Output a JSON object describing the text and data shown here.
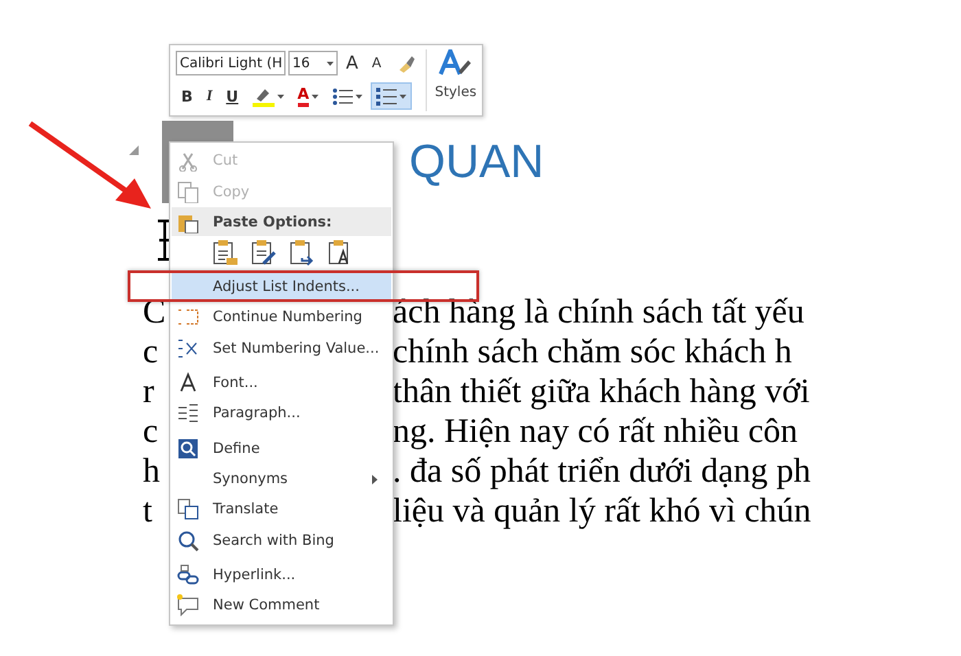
{
  "mini_toolbar": {
    "font": {
      "value": "Calibri Light (H"
    },
    "size": {
      "value": "16"
    },
    "row_1": [
      {
        "kind": "grow",
        "label": "A"
      },
      {
        "kind": "shrink",
        "label": "A"
      },
      {
        "kind": "painter"
      }
    ],
    "row_2": [
      {
        "kind": "bold",
        "label": "B",
        "selected": false
      },
      {
        "kind": "italic",
        "label": "I",
        "selected": false
      },
      {
        "kind": "underline",
        "label": "U",
        "selected": false
      },
      {
        "kind": "highlight",
        "selected": false
      },
      {
        "kind": "font_color",
        "label": "A",
        "selected": false
      },
      {
        "kind": "bullets",
        "selected": false
      },
      {
        "kind": "numbering",
        "selected": true
      }
    ],
    "styles_label": "Styles"
  },
  "document": {
    "heading": "QUAN",
    "lines": [
      {
        "start": "C",
        "rest": "ách hàng là chính sách tất yếu"
      },
      {
        "start": "c",
        "rest": "chính sách chăm sóc khách h"
      },
      {
        "start": "r",
        "rest": "thân thiết giữa khách hàng với"
      },
      {
        "start": "c",
        "rest": "ng. Hiện nay có rất nhiều côn"
      },
      {
        "start": "h",
        "rest": ". đa số phát triển dưới dạng ph"
      },
      {
        "start": "t",
        "rest": "liệu và quản lý rất khó vì chún"
      }
    ]
  },
  "context_menu": {
    "items": [
      {
        "kind": "command",
        "label": "Cut",
        "disabled": true,
        "selected": false,
        "submenu": false,
        "separator_before": false
      },
      {
        "kind": "command",
        "label": "Copy",
        "disabled": true,
        "selected": false,
        "submenu": false,
        "separator_before": false
      },
      {
        "kind": "header",
        "label": "Paste Options:"
      },
      {
        "kind": "paste_icons"
      },
      {
        "kind": "command",
        "label": "Adjust List Indents...",
        "disabled": false,
        "selected": true,
        "submenu": false,
        "separator_before": true
      },
      {
        "kind": "command",
        "label": "Continue Numbering",
        "disabled": false,
        "selected": false,
        "submenu": false,
        "separator_before": false
      },
      {
        "kind": "command",
        "label": "Set Numbering Value...",
        "disabled": false,
        "selected": false,
        "submenu": false,
        "separator_before": false
      },
      {
        "kind": "command",
        "label": "Font...",
        "disabled": false,
        "selected": false,
        "submenu": false,
        "separator_before": true
      },
      {
        "kind": "command",
        "label": "Paragraph...",
        "disabled": false,
        "selected": false,
        "submenu": false,
        "separator_before": false
      },
      {
        "kind": "command",
        "label": "Define",
        "disabled": false,
        "selected": false,
        "submenu": false,
        "separator_before": true
      },
      {
        "kind": "command",
        "label": "Synonyms",
        "disabled": false,
        "selected": false,
        "submenu": true,
        "separator_before": false
      },
      {
        "kind": "command",
        "label": "Translate",
        "disabled": false,
        "selected": false,
        "submenu": false,
        "separator_before": false
      },
      {
        "kind": "command",
        "label": "Search with Bing",
        "disabled": false,
        "selected": false,
        "submenu": false,
        "separator_before": false
      },
      {
        "kind": "command",
        "label": "Hyperlink...",
        "disabled": false,
        "selected": false,
        "submenu": false,
        "separator_before": true
      },
      {
        "kind": "command",
        "label": "New Comment",
        "disabled": false,
        "selected": false,
        "submenu": false,
        "separator_before": false
      }
    ]
  }
}
